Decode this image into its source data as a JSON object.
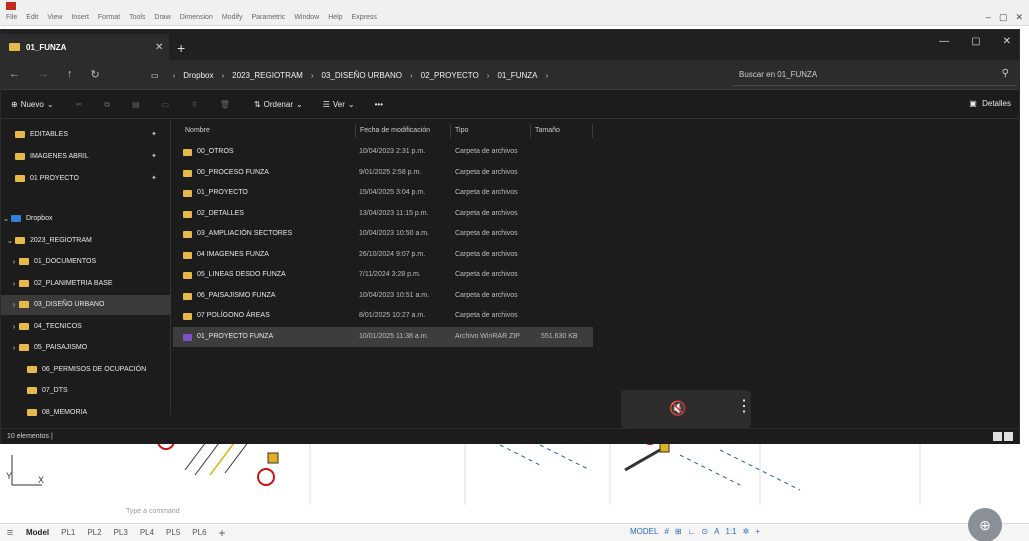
{
  "colors": {
    "explorer_bg": "#1c1c1c",
    "folder": "#e6b94a",
    "dropbox": "#2f7fd6",
    "zip": "#7b53c9",
    "selection": "#3d3d3d"
  },
  "cad": {
    "menu": [
      "File",
      "Edit",
      "View",
      "Insert",
      "Format",
      "Tools",
      "Draw",
      "Dimension",
      "Modify",
      "Parametric",
      "Window",
      "Help",
      "Express"
    ],
    "command_placeholder": "Type a command",
    "status_tabs": [
      "Model",
      "PL1",
      "PL2",
      "PL3",
      "PL4",
      "PL5",
      "PL6"
    ],
    "status_right": "MODEL"
  },
  "explorer": {
    "tab_title": "01_FUNZA",
    "breadcrumb": [
      "Dropbox",
      "2023_REGIOTRAM",
      "03_DISEÑO URBANO",
      "02_PROYECTO",
      "01_FUNZA"
    ],
    "search_placeholder": "Buscar en 01_FUNZA",
    "toolbar": {
      "new": "Nuevo",
      "sort": "Ordenar",
      "view": "Ver",
      "more": "•••",
      "details": "Detalles"
    },
    "nav": {
      "quick_access": [
        "EDITABLES",
        "IMAGENES ABRIL",
        "01 PROYECTO"
      ],
      "dropbox": "Dropbox",
      "tree": [
        {
          "label": "2023_REGIOTRAM",
          "indent": 1
        },
        {
          "label": "01_DOCUMENTOS",
          "indent": 2
        },
        {
          "label": "02_PLANIMETRIA BASE",
          "indent": 2
        },
        {
          "label": "03_DISEÑO URBANO",
          "indent": 2,
          "selected": true
        },
        {
          "label": "04_TECNICOS",
          "indent": 2
        },
        {
          "label": "05_PAISAJISMO",
          "indent": 2
        },
        {
          "label": "06_PERMISOS DE OCUPACIÓN",
          "indent": 2
        },
        {
          "label": "07_DTS",
          "indent": 2
        },
        {
          "label": "08_MEMORIA",
          "indent": 2
        }
      ]
    },
    "columns": [
      "Nombre",
      "Fecha de modificación",
      "Tipo",
      "Tamaño"
    ],
    "files": [
      {
        "name": "00_OTROS",
        "date": "10/04/2023 2:31 p.m.",
        "type": "Carpeta de archivos",
        "size": ""
      },
      {
        "name": "00_PROCESO FUNZA",
        "date": "9/01/2025 2:58 p.m.",
        "type": "Carpeta de archivos",
        "size": ""
      },
      {
        "name": "01_PROYECTO",
        "date": "15/04/2025 3:04 p.m.",
        "type": "Carpeta de archivos",
        "size": ""
      },
      {
        "name": "02_DETALLES",
        "date": "13/04/2023 11:15 p.m.",
        "type": "Carpeta de archivos",
        "size": ""
      },
      {
        "name": "03_AMPLIACIÓN SECTORES",
        "date": "10/04/2023 10:50 a.m.",
        "type": "Carpeta de archivos",
        "size": ""
      },
      {
        "name": "04 IMAGENES FUNZA",
        "date": "26/10/2024 9:07 p.m.",
        "type": "Carpeta de archivos",
        "size": ""
      },
      {
        "name": "05_LINEAS DESDO FUNZA",
        "date": "7/11/2024 3:28 p.m.",
        "type": "Carpeta de archivos",
        "size": ""
      },
      {
        "name": "06_PAISAJISMO FUNZA",
        "date": "10/04/2023 10:51 a.m.",
        "type": "Carpeta de archivos",
        "size": ""
      },
      {
        "name": "07 POLÍGONO ÁREAS",
        "date": "8/01/2025 10:27 a.m.",
        "type": "Carpeta de archivos",
        "size": ""
      },
      {
        "name": "01_PROYECTO FUNZA",
        "date": "10/01/2025 11:38 a.m.",
        "type": "Archivo WinRAR ZIP",
        "size": "551.630 KB",
        "zip": true,
        "selected": true
      }
    ],
    "status": "10 elementos |"
  }
}
